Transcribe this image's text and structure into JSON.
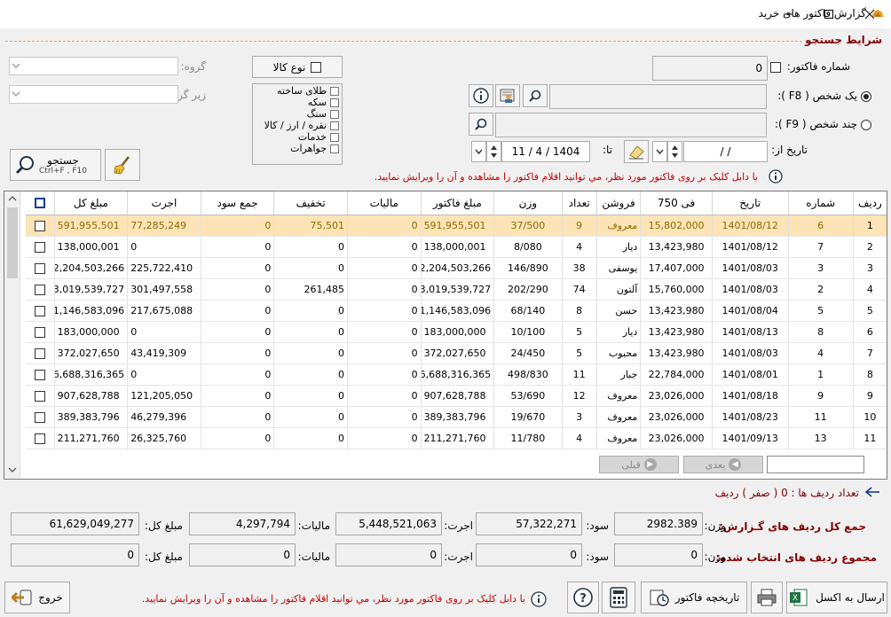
{
  "window": {
    "title": "گزارش فاكتور های خرید"
  },
  "section_title": "شرایط جستجو",
  "criteria": {
    "invoice_number_label": "شماره فاکتور:",
    "invoice_number_value": "0",
    "one_person_label": "یک شخص ( F8 ):",
    "many_persons_label": "چند شخص ( F9 ):",
    "date_from_label": "تاریخ از:",
    "date_from_value": "/    /",
    "date_to_label": "تا:",
    "date_to_value": "1404 / 4 / 11",
    "goods_type_label": "نوع کالا",
    "group_label": "گروه:",
    "subgroup_label": "زیر گروه:",
    "goods_types": [
      "طلای ساخته",
      "سکه",
      "سنگ",
      "نقره / ارز / کالا",
      "خدمات",
      "جواهرات"
    ],
    "hint": "با دابل کلیک بر روی فاکتور مورد نظر، مي توانید اقلام فاکتور را مشاهده و آن را ویرایش نمایید.",
    "search_button": "جستجو",
    "search_shortcut": "Ctrl+F , F10"
  },
  "table": {
    "columns": [
      "ردیف",
      "شماره",
      "تاریخ",
      "فی 750",
      "فروشن",
      "تعداد",
      "وزن",
      "مبلغ فاکتور",
      "مالیات",
      "تخفیف",
      "جمع سود",
      "اجرت",
      "مبلغ کل"
    ],
    "rows": [
      [
        "1",
        "6",
        "1401/08/12",
        "15,802,000",
        "معروف",
        "9",
        "37/500",
        "591,955,501",
        "0",
        "75,501",
        "0",
        "77,285,249",
        "591,955,501"
      ],
      [
        "2",
        "7",
        "1401/08/12",
        "13,423,980",
        "دیار",
        "4",
        "8/080",
        "138,000,001",
        "0",
        "0",
        "0",
        "0",
        "138,000,001"
      ],
      [
        "3",
        "3",
        "1401/08/03",
        "17,407,000",
        "یوسفی",
        "38",
        "146/890",
        "2,204,503,266",
        "0",
        "0",
        "0",
        "225,722,410",
        "2,204,503,266"
      ],
      [
        "4",
        "2",
        "1401/08/03",
        "15,760,000",
        "آلتون",
        "74",
        "202/290",
        "3,019,539,727",
        "0",
        "261,485",
        "0",
        "301,497,558",
        "3,019,539,727"
      ],
      [
        "5",
        "5",
        "1401/08/04",
        "13,423,980",
        "حسن",
        "8",
        "68/140",
        "1,146,583,096",
        "0",
        "0",
        "0",
        "217,675,088",
        "1,146,583,096"
      ],
      [
        "6",
        "8",
        "1401/08/13",
        "13,423,980",
        "دیار",
        "5",
        "10/100",
        "183,000,000",
        "0",
        "0",
        "0",
        "0",
        "183,000,000"
      ],
      [
        "7",
        "4",
        "1401/08/03",
        "13,423,980",
        "محبوب",
        "5",
        "24/450",
        "372,027,650",
        "0",
        "0",
        "0",
        "43,419,309",
        "372,027,650"
      ],
      [
        "8",
        "1",
        "1401/08/01",
        "22,784,000",
        "جبار",
        "11",
        "498/830",
        "6,688,316,365",
        "0",
        "0",
        "0",
        "0",
        "6,688,316,365"
      ],
      [
        "9",
        "9",
        "1401/08/18",
        "23,026,000",
        "معروف",
        "12",
        "53/690",
        "907,628,788",
        "0",
        "0",
        "0",
        "121,205,050",
        "907,628,788"
      ],
      [
        "10",
        "11",
        "1401/08/23",
        "23,026,000",
        "معروف",
        "3",
        "19/670",
        "389,383,796",
        "0",
        "0",
        "0",
        "46,279,396",
        "389,383,796"
      ],
      [
        "11",
        "13",
        "1401/09/13",
        "23,026,000",
        "معروف",
        "4",
        "11/780",
        "211,271,760",
        "0",
        "0",
        "0",
        "26,325,760",
        "211,271,760"
      ]
    ],
    "prev_label": "قبلی",
    "next_label": "بعدی"
  },
  "rows_count_label": "تعداد ردیف ها : 0 ( صفر ) ردیف",
  "totals": {
    "report_label": "جمع کل ردیف های گـزارش:",
    "selected_label": "مجموع ردیف های انتخاب شده:",
    "weight_label": "وزن:",
    "profit_label": "سود:",
    "wage_label": "اجرت:",
    "tax_label": "مالیات:",
    "total_label": "مبلغ کل:",
    "report": {
      "weight": "2982.389",
      "profit": "57,322,271",
      "wage": "5,448,521,063",
      "tax": "4,297,794",
      "total": "61,629,049,277"
    },
    "selected": {
      "weight": "0",
      "profit": "0",
      "wage": "0",
      "tax": "0",
      "total": "0"
    }
  },
  "footer": {
    "export_excel": "ارسال به اکسل",
    "invoice_history": "تاریخچه فاکتور",
    "hint": "با دابل کلیک بر روی فاکتور مورد نظر، مي توانید اقلام فاکتور را مشاهده و آن را ویرایش نمایید.",
    "exit": "خروج"
  }
}
